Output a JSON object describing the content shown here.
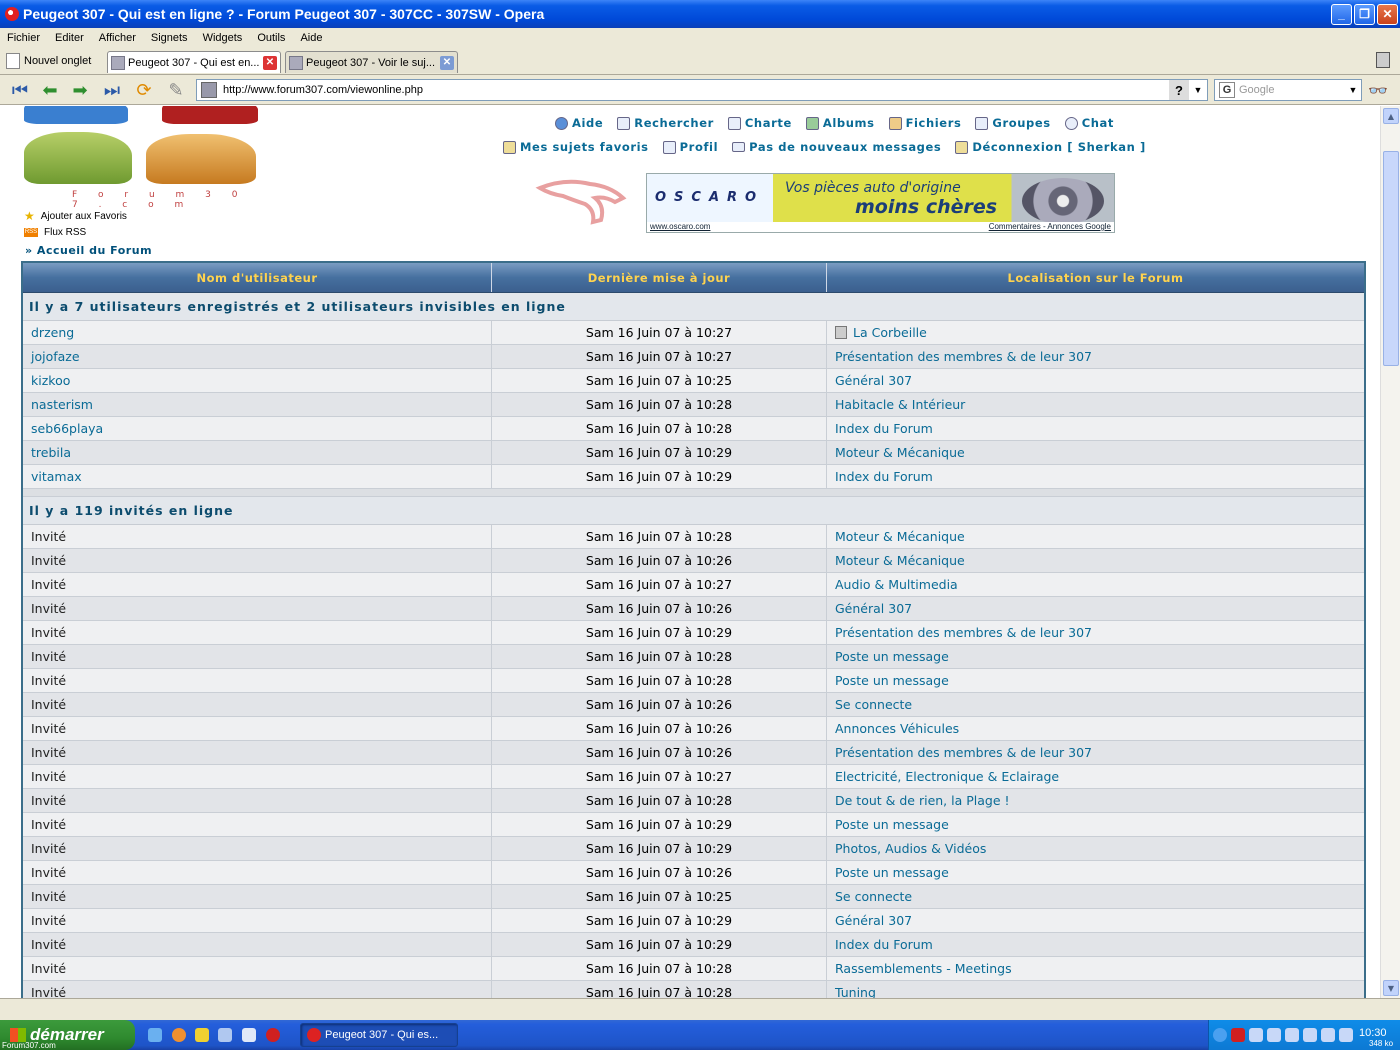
{
  "window": {
    "title": "Peugeot 307 - Qui est en ligne ? - Forum Peugeot 307 - 307CC - 307SW - Opera"
  },
  "menu": [
    "Fichier",
    "Editer",
    "Afficher",
    "Signets",
    "Widgets",
    "Outils",
    "Aide"
  ],
  "tabs": {
    "new_tab": "Nouvel onglet",
    "items": [
      {
        "label": "Peugeot 307 - Qui est en..."
      },
      {
        "label": "Peugeot 307 - Voir le suj..."
      }
    ]
  },
  "address": {
    "url": "http://www.forum307.com/viewonline.php",
    "help": "?",
    "search_placeholder": "Google"
  },
  "page": {
    "logo_text": "F o r u m 3 0 7 . c o m",
    "fav_link": "Ajouter aux Favoris",
    "rss_link": "Flux RSS",
    "rss_icon": "RSS",
    "home_link": "» Accueil du Forum",
    "nav1": [
      "Aide",
      "Rechercher",
      "Charte",
      "Albums",
      "Fichiers",
      "Groupes",
      "Chat"
    ],
    "nav2": [
      "Mes sujets favoris",
      "Profil",
      "Pas de nouveaux messages",
      "Déconnexion [ Sherkan ]"
    ],
    "ad": {
      "brand": "OSCARO",
      "line1": "Vos pièces auto d'origine",
      "line2": "moins chères",
      "url": "www.oscaro.com",
      "footer": "Commentaires - Annonces Google"
    }
  },
  "table": {
    "headers": [
      "Nom d'utilisateur",
      "Dernière mise à jour",
      "Localisation sur le Forum"
    ],
    "registered_title": "Il y a 7 utilisateurs enregistrés et 2 utilisateurs invisibles en ligne",
    "registered": [
      {
        "name": "drzeng",
        "time": "Sam 16 Juin 07 à 10:27",
        "loc": "La Corbeille"
      },
      {
        "name": "jojofaze",
        "time": "Sam 16 Juin 07 à 10:27",
        "loc": "Présentation des membres & de leur 307"
      },
      {
        "name": "kizkoo",
        "time": "Sam 16 Juin 07 à 10:25",
        "loc": "Général 307"
      },
      {
        "name": "nasterism",
        "time": "Sam 16 Juin 07 à 10:28",
        "loc": "Habitacle & Intérieur"
      },
      {
        "name": "seb66playa",
        "time": "Sam 16 Juin 07 à 10:28",
        "loc": "Index du Forum"
      },
      {
        "name": "trebila",
        "time": "Sam 16 Juin 07 à 10:29",
        "loc": "Moteur & Mécanique"
      },
      {
        "name": "vitamax",
        "time": "Sam 16 Juin 07 à 10:29",
        "loc": "Index du Forum"
      }
    ],
    "guests_title": "Il y a 119 invités en ligne",
    "guests": [
      {
        "name": "Invité",
        "time": "Sam 16 Juin 07 à 10:28",
        "loc": "Moteur & Mécanique"
      },
      {
        "name": "Invité",
        "time": "Sam 16 Juin 07 à 10:26",
        "loc": "Moteur & Mécanique"
      },
      {
        "name": "Invité",
        "time": "Sam 16 Juin 07 à 10:27",
        "loc": "Audio & Multimedia"
      },
      {
        "name": "Invité",
        "time": "Sam 16 Juin 07 à 10:26",
        "loc": "Général 307"
      },
      {
        "name": "Invité",
        "time": "Sam 16 Juin 07 à 10:29",
        "loc": "Présentation des membres & de leur 307"
      },
      {
        "name": "Invité",
        "time": "Sam 16 Juin 07 à 10:28",
        "loc": "Poste un message"
      },
      {
        "name": "Invité",
        "time": "Sam 16 Juin 07 à 10:28",
        "loc": "Poste un message"
      },
      {
        "name": "Invité",
        "time": "Sam 16 Juin 07 à 10:26",
        "loc": "Se connecte"
      },
      {
        "name": "Invité",
        "time": "Sam 16 Juin 07 à 10:26",
        "loc": "Annonces Véhicules"
      },
      {
        "name": "Invité",
        "time": "Sam 16 Juin 07 à 10:26",
        "loc": "Présentation des membres & de leur 307"
      },
      {
        "name": "Invité",
        "time": "Sam 16 Juin 07 à 10:27",
        "loc": "Electricité, Electronique & Eclairage"
      },
      {
        "name": "Invité",
        "time": "Sam 16 Juin 07 à 10:28",
        "loc": "De tout & de rien, la Plage !"
      },
      {
        "name": "Invité",
        "time": "Sam 16 Juin 07 à 10:29",
        "loc": "Poste un message"
      },
      {
        "name": "Invité",
        "time": "Sam 16 Juin 07 à 10:29",
        "loc": "Photos, Audios & Vidéos"
      },
      {
        "name": "Invité",
        "time": "Sam 16 Juin 07 à 10:26",
        "loc": "Poste un message"
      },
      {
        "name": "Invité",
        "time": "Sam 16 Juin 07 à 10:25",
        "loc": "Se connecte"
      },
      {
        "name": "Invité",
        "time": "Sam 16 Juin 07 à 10:29",
        "loc": "Général 307"
      },
      {
        "name": "Invité",
        "time": "Sam 16 Juin 07 à 10:29",
        "loc": "Index du Forum"
      },
      {
        "name": "Invité",
        "time": "Sam 16 Juin 07 à 10:28",
        "loc": "Rassemblements - Meetings"
      },
      {
        "name": "Invité",
        "time": "Sam 16 Juin 07 à 10:28",
        "loc": "Tuning"
      }
    ]
  },
  "taskbar": {
    "start": "démarrer",
    "brand": "Forum307.com",
    "task": "Peugeot 307 - Qui es...",
    "clock": "10:30",
    "traffic": "348 ko"
  },
  "colors": {
    "link": "#0a6b96",
    "header_text": "#ffd34e",
    "header_bg": "#46709f",
    "section_bg": "#e3e7ec"
  }
}
